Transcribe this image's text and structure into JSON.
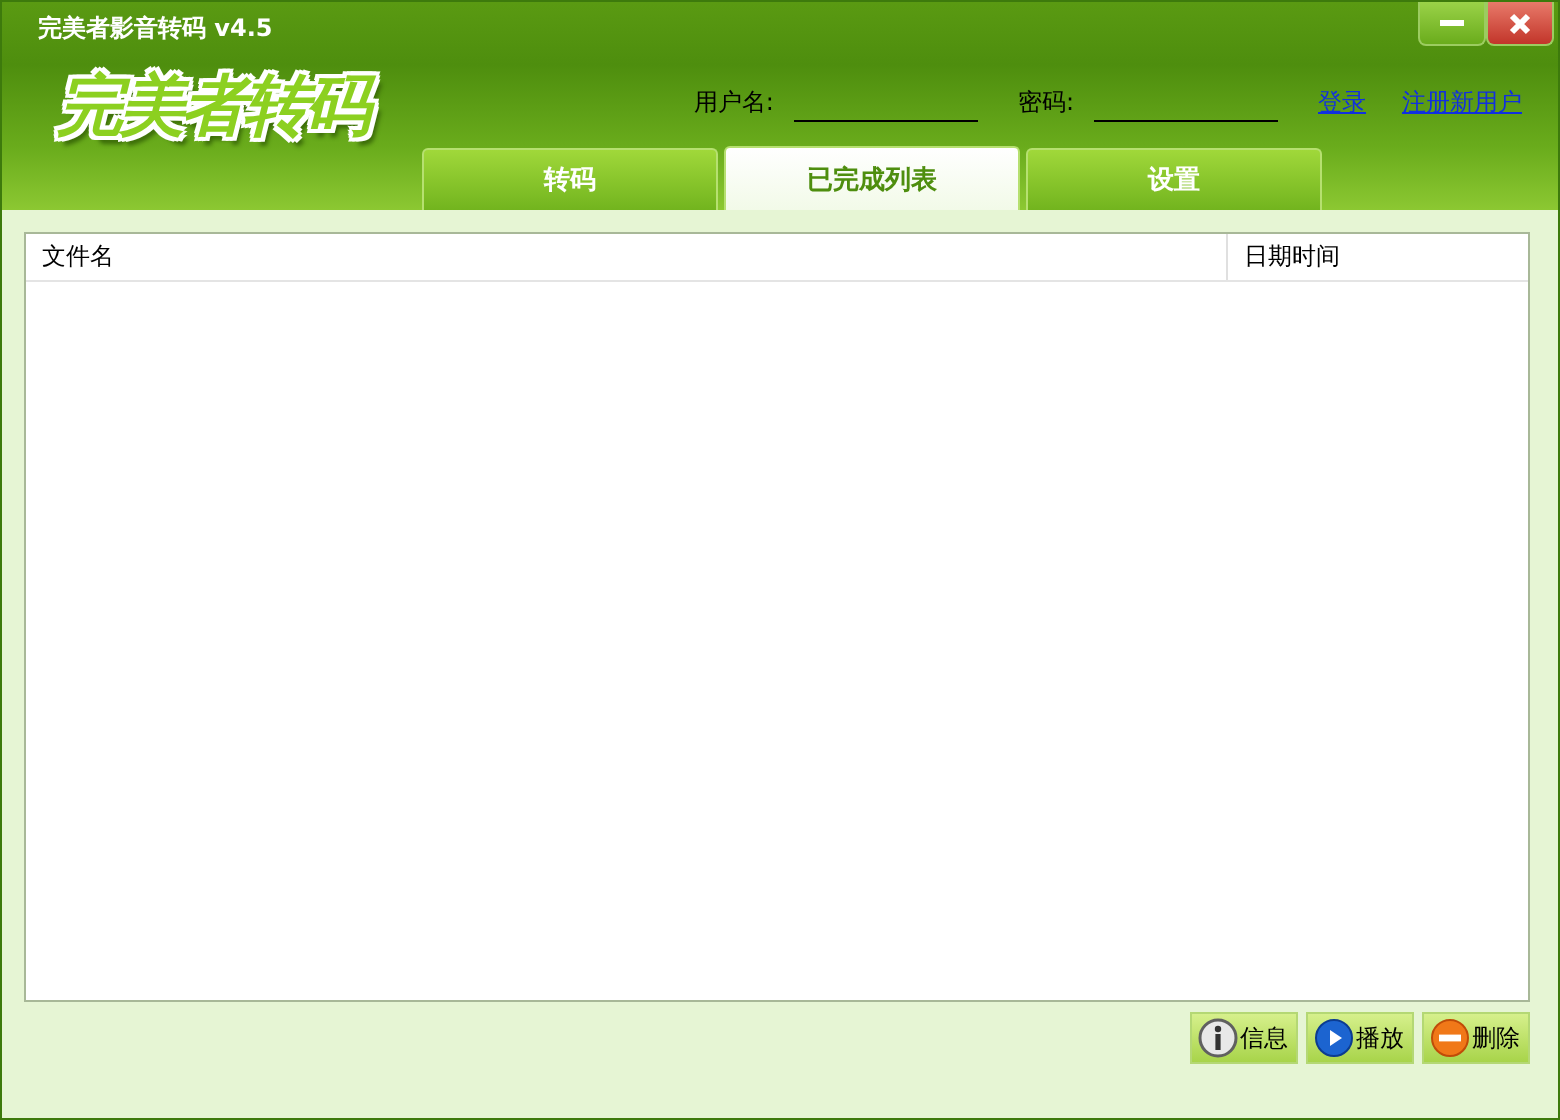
{
  "window": {
    "title": "完美者影音转码 v4.5"
  },
  "logo": "完美者转码",
  "login": {
    "username_label": "用户名:",
    "password_label": "密码:",
    "login_link": "登录",
    "register_link": "注册新用户"
  },
  "tabs": [
    {
      "label": "转码",
      "selected": false
    },
    {
      "label": "已完成列表",
      "selected": true
    },
    {
      "label": "设置",
      "selected": false
    }
  ],
  "table": {
    "columns": [
      "文件名",
      "日期时间"
    ]
  },
  "buttons": [
    {
      "label": "信息",
      "kind": "info"
    },
    {
      "label": "播放",
      "kind": "play"
    },
    {
      "label": "删除",
      "kind": "delete"
    }
  ]
}
